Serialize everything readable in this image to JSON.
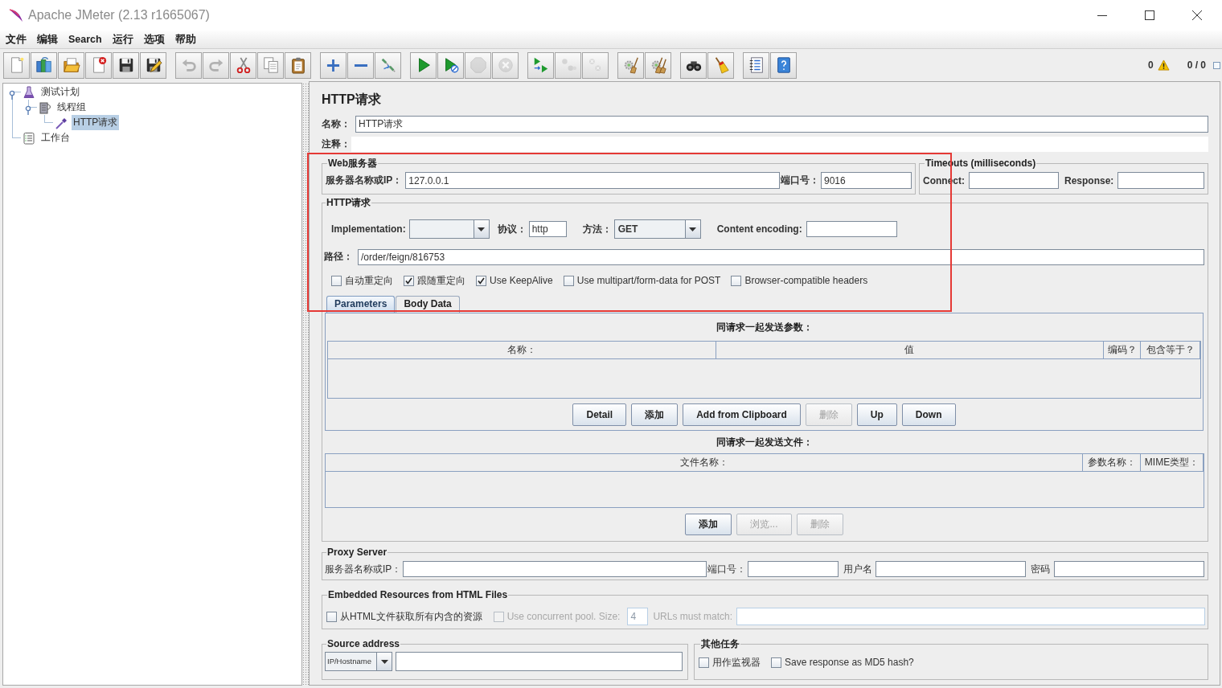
{
  "window": {
    "title": "Apache JMeter (2.13 r1665067)"
  },
  "menu": [
    "文件",
    "编辑",
    "Search",
    "运行",
    "选项",
    "帮助"
  ],
  "toolbar": {
    "groups": [
      [
        {
          "kind": "new",
          "disabled": false
        },
        {
          "kind": "templates",
          "disabled": false
        },
        {
          "kind": "open",
          "disabled": false
        },
        {
          "kind": "close",
          "disabled": false
        },
        {
          "kind": "save",
          "disabled": false
        },
        {
          "kind": "save_as",
          "disabled": false
        }
      ],
      [
        {
          "kind": "undo",
          "disabled": true
        },
        {
          "kind": "redo",
          "disabled": true
        },
        {
          "kind": "cut",
          "disabled": false
        },
        {
          "kind": "copy",
          "disabled": false
        },
        {
          "kind": "paste",
          "disabled": false
        }
      ],
      [
        {
          "kind": "expand",
          "disabled": false
        },
        {
          "kind": "collapse",
          "disabled": false
        },
        {
          "kind": "toggle",
          "disabled": false
        }
      ],
      [
        {
          "kind": "start",
          "disabled": false
        },
        {
          "kind": "start_no_timers",
          "disabled": false
        },
        {
          "kind": "stop",
          "disabled": true
        },
        {
          "kind": "shutdown",
          "disabled": true
        }
      ],
      [
        {
          "kind": "remote_start",
          "disabled": false
        },
        {
          "kind": "remote_stop",
          "disabled": true
        },
        {
          "kind": "remote_exit",
          "disabled": true
        }
      ],
      [
        {
          "kind": "clear",
          "disabled": false
        },
        {
          "kind": "clear_all",
          "disabled": false
        }
      ],
      [
        {
          "kind": "search",
          "disabled": false
        },
        {
          "kind": "reset_search",
          "disabled": false
        }
      ],
      [
        {
          "kind": "functions",
          "disabled": false
        },
        {
          "kind": "help",
          "disabled": false
        }
      ]
    ]
  },
  "status": {
    "errors": "0",
    "threads": "0 / 0"
  },
  "tree": [
    {
      "label": "测试计划",
      "kind": "plan",
      "selected": false,
      "expanded": true,
      "children": [
        {
          "label": "线程组",
          "kind": "thread_group",
          "selected": false,
          "expanded": true,
          "children": [
            {
              "label": "HTTP请求",
              "kind": "sampler",
              "selected": true
            }
          ]
        }
      ]
    },
    {
      "label": "工作台",
      "kind": "workbench",
      "selected": false
    }
  ],
  "sampler": {
    "title": "HTTP请求",
    "name": {
      "label": "名称：",
      "value": "HTTP请求"
    },
    "comments": {
      "label": "注释："
    },
    "web_server": {
      "title": "Web服务器",
      "server": {
        "label": "服务器名称或IP：",
        "value": "127.0.0.1"
      },
      "port": {
        "label": "端口号：",
        "value": "9016"
      }
    },
    "timeouts": {
      "title": "Timeouts (milliseconds)",
      "connect": {
        "label": "Connect:"
      },
      "response": {
        "label": "Response:"
      }
    },
    "http_request": {
      "title": "HTTP请求",
      "implementation": {
        "label": "Implementation:"
      },
      "protocol": {
        "label": "协议：",
        "value": "http"
      },
      "method": {
        "label": "方法：",
        "value": "GET"
      },
      "encoding": {
        "label": "Content encoding:"
      },
      "path": {
        "label": "路径：",
        "value": "/order/feign/816753"
      },
      "options": [
        {
          "label": "自动重定向",
          "checked": false
        },
        {
          "label": "跟随重定向",
          "checked": true
        },
        {
          "label": "Use KeepAlive",
          "checked": true
        },
        {
          "label": "Use multipart/form-data for POST",
          "checked": false
        },
        {
          "label": "Browser-compatible headers",
          "checked": false
        }
      ],
      "tabs": [
        {
          "label": "Parameters",
          "selected": true
        },
        {
          "label": "Body Data",
          "selected": false
        }
      ],
      "parameters": {
        "title": "同请求一起发送参数：",
        "columns": [
          "名称：",
          "值",
          "编码？",
          "包含等于？"
        ],
        "buttons": [
          {
            "label": "Detail",
            "disabled": false
          },
          {
            "label": "添加",
            "disabled": false
          },
          {
            "label": "Add from Clipboard",
            "disabled": false
          },
          {
            "label": "删除",
            "disabled": true
          },
          {
            "label": "Up",
            "disabled": false
          },
          {
            "label": "Down",
            "disabled": false
          }
        ]
      },
      "files": {
        "title": "同请求一起发送文件：",
        "columns": [
          "文件名称：",
          "参数名称：",
          "MIME类型："
        ],
        "buttons": [
          {
            "label": "添加",
            "disabled": false
          },
          {
            "label": "浏览...",
            "disabled": true
          },
          {
            "label": "删除",
            "disabled": true
          }
        ]
      }
    },
    "proxy": {
      "title": "Proxy Server",
      "fields": [
        {
          "label": "服务器名称或IP："
        },
        {
          "label": "端口号："
        },
        {
          "label": "用户名"
        },
        {
          "label": "密码"
        }
      ]
    },
    "embedded": {
      "title": "Embedded Resources from HTML Files",
      "retrieve": {
        "label": "从HTML文件获取所有内含的资源",
        "checked": false
      },
      "concurrent": {
        "label": "Use concurrent pool. Size:",
        "checked": false,
        "disabled": true
      },
      "pool_size": {
        "value": "4",
        "disabled": true
      },
      "url_match": {
        "label": "URLs must match:",
        "disabled": true
      }
    },
    "source": {
      "title": "Source address",
      "type": {
        "value": "IP/Hostname"
      }
    },
    "other": {
      "title": "其他任务",
      "options": [
        {
          "label": "用作监视器",
          "checked": false
        },
        {
          "label": "Save response as MD5 hash?",
          "checked": false
        }
      ]
    }
  }
}
